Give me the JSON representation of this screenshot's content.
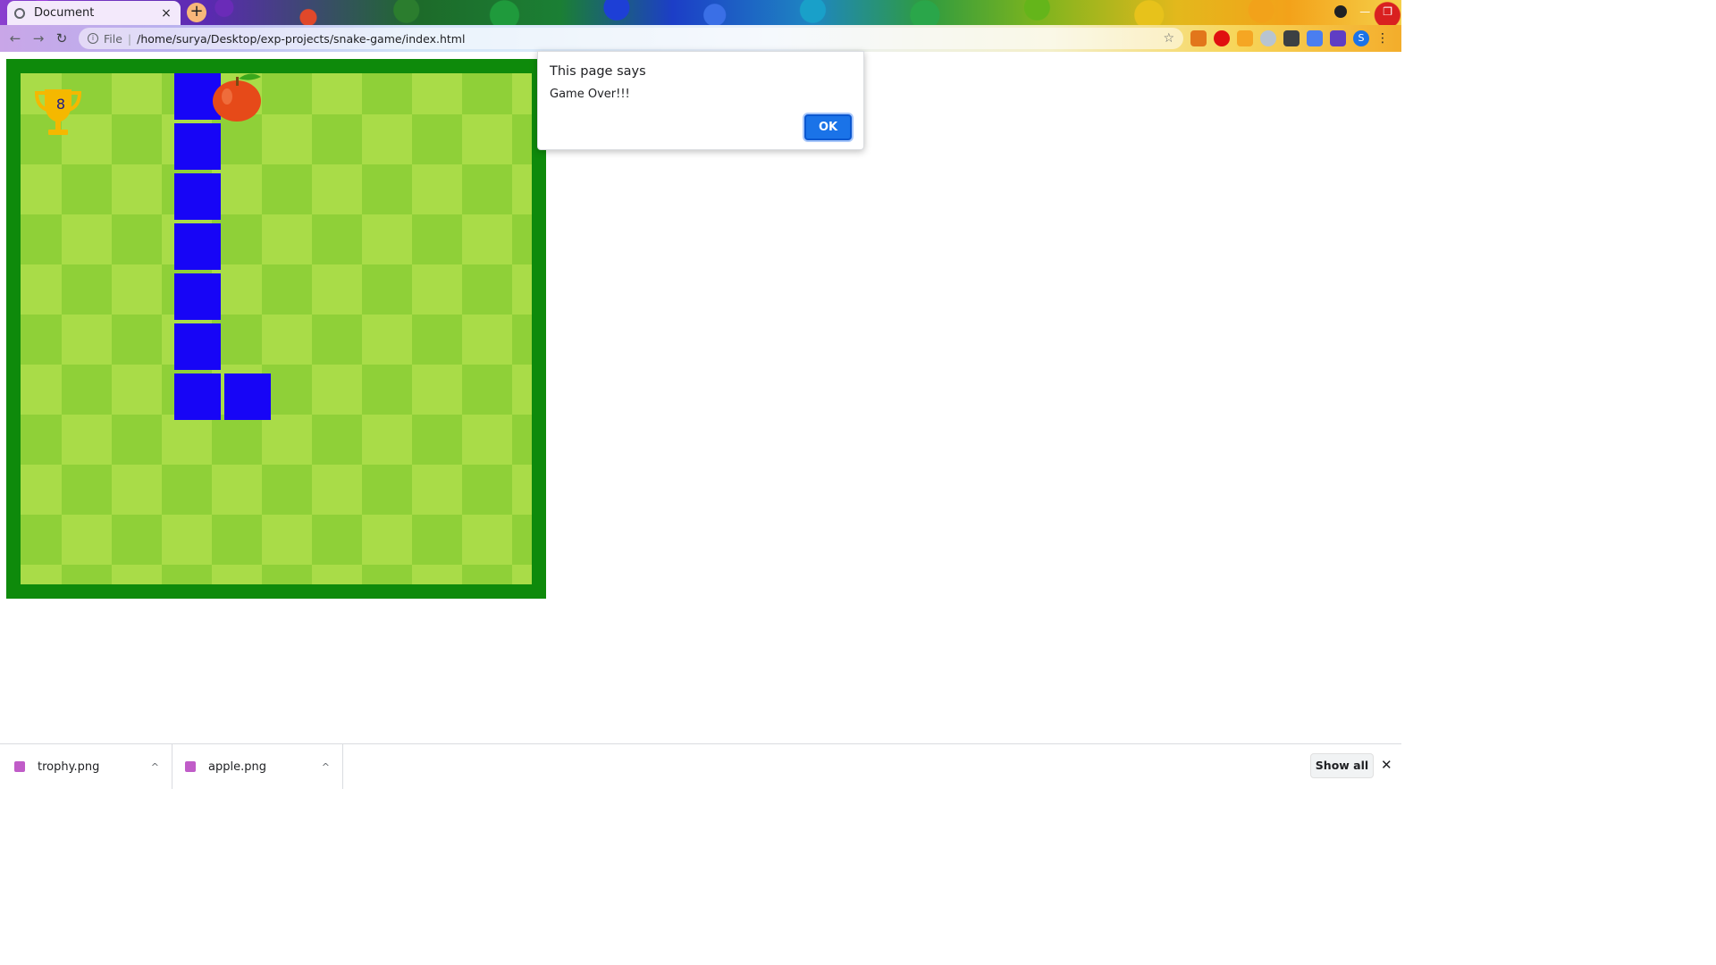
{
  "browser": {
    "tab_title": "Document",
    "tab_close": "×",
    "new_tab": "+",
    "url_scheme": "File",
    "url_separator": "|",
    "url": "/home/surya/Desktop/exp-projects/snake-game/index.html",
    "profile_initial": "S",
    "kebab": "⋮",
    "back": "←",
    "forward": "→",
    "reload": "↻",
    "star": "☆",
    "minimize": "—",
    "restore": "❐"
  },
  "game": {
    "score": "8",
    "grid_cols": 11,
    "grid_rows": 11,
    "snake_cells": [
      [
        3,
        0
      ],
      [
        3,
        1
      ],
      [
        3,
        2
      ],
      [
        3,
        3
      ],
      [
        3,
        4
      ],
      [
        3,
        5
      ],
      [
        3,
        6
      ],
      [
        4,
        6
      ]
    ],
    "apple_cell": [
      4,
      0
    ],
    "trophy_cell": [
      0,
      0
    ],
    "colors": {
      "border": "#0e8a0b",
      "light": "#a9dc48",
      "dark": "#8fd038",
      "snake": "#1705f6",
      "apple": "#e64a19",
      "trophy": "#f5b800"
    }
  },
  "dialog": {
    "title": "This page says",
    "message": "Game Over!!!",
    "ok_label": "OK"
  },
  "downloads": {
    "items": [
      {
        "name": "trophy.png"
      },
      {
        "name": "apple.png"
      }
    ],
    "show_all": "Show all",
    "close": "✕",
    "chevron": "^"
  }
}
